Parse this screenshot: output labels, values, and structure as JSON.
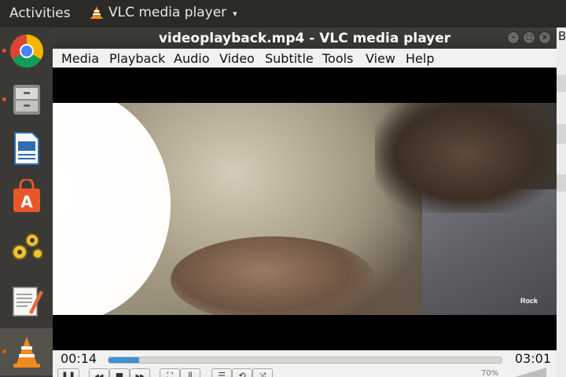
{
  "topbar": {
    "activities": "Activities",
    "app_name": "VLC media player",
    "caret": "▾"
  },
  "dock": {
    "items": [
      {
        "name": "chrome",
        "running": true
      },
      {
        "name": "files",
        "running": true
      },
      {
        "name": "writer",
        "running": false
      },
      {
        "name": "software",
        "running": false
      },
      {
        "name": "settings",
        "running": false
      },
      {
        "name": "text-editor",
        "running": false
      },
      {
        "name": "vlc",
        "running": true
      }
    ]
  },
  "background_window": {
    "partial_text": "Ba"
  },
  "window": {
    "title": "videoplayback.mp4 - VLC media player",
    "buttons": {
      "minimize": "–",
      "maximize": "□",
      "close": "×"
    }
  },
  "menu": {
    "items": [
      "Media",
      "Playback",
      "Audio",
      "Video",
      "Subtitle",
      "Tools",
      "View",
      "Help"
    ]
  },
  "video": {
    "watermark": "Rock"
  },
  "player": {
    "elapsed": "00:14",
    "total": "03:01",
    "progress": 0.077,
    "volume": "70%"
  },
  "controls": {
    "play_pause": "❚❚",
    "prev": "◂◂",
    "stop": "■",
    "next": "▸▸",
    "fullscreen": "⛶",
    "extended": "⫼",
    "playlist": "☰",
    "loop": "⟲",
    "shuffle": "⤨"
  }
}
